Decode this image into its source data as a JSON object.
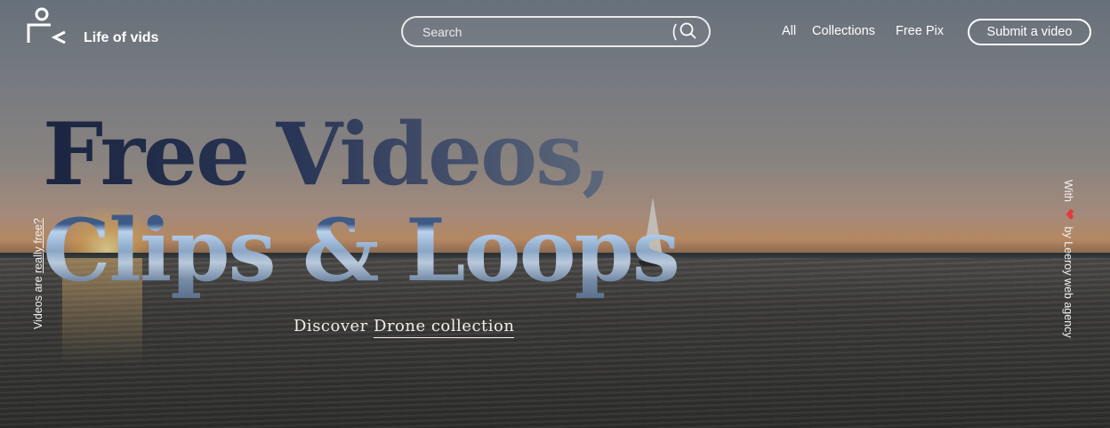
{
  "brand": {
    "name": "Life of vids"
  },
  "search": {
    "placeholder": "Search"
  },
  "nav": {
    "items": [
      {
        "label": "All"
      },
      {
        "label": "Collections"
      },
      {
        "label": "Free Pix"
      }
    ],
    "submit_label": "Submit a video"
  },
  "hero": {
    "headline_line1": "Free Videos,",
    "headline_line2": "Clips & Loops",
    "discover_prefix": "Discover",
    "discover_link": "Drone collection"
  },
  "side": {
    "left_prefix": "Videos are ",
    "left_link": "really free?",
    "right_prefix": "With",
    "right_suffix": "by Leeroy web agency"
  },
  "colors": {
    "text": "#ffffff",
    "heart": "#e5393c",
    "headline_dark": "#1b2540"
  },
  "icons": [
    "logo-icon",
    "search-icon",
    "heart-icon"
  ]
}
